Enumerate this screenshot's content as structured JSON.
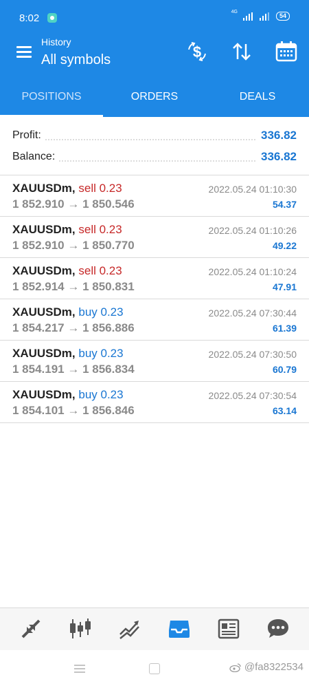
{
  "status_bar": {
    "time": "8:02",
    "network_label": "4G",
    "battery": "54"
  },
  "app_bar": {
    "subtitle": "History",
    "title": "All symbols"
  },
  "tabs": [
    {
      "label": "POSITIONS",
      "active": true
    },
    {
      "label": "ORDERS",
      "active": false
    },
    {
      "label": "DEALS",
      "active": false
    }
  ],
  "summary": {
    "profit_label": "Profit:",
    "profit_value": "336.82",
    "balance_label": "Balance:",
    "balance_value": "336.82"
  },
  "deals": [
    {
      "symbol": "XAUUSDm,",
      "type": "sell 0.23",
      "prices": "1 852.910 → 1 850.546",
      "time": "2022.05.24 01:10:30",
      "profit": "54.37"
    },
    {
      "symbol": "XAUUSDm,",
      "type": "sell 0.23",
      "prices": "1 852.910 → 1 850.770",
      "time": "2022.05.24 01:10:26",
      "profit": "49.22"
    },
    {
      "symbol": "XAUUSDm,",
      "type": "sell 0.23",
      "prices": "1 852.914 → 1 850.831",
      "time": "2022.05.24 01:10:24",
      "profit": "47.91"
    },
    {
      "symbol": "XAUUSDm,",
      "type": "buy 0.23",
      "prices": "1 854.217 → 1 856.886",
      "time": "2022.05.24 07:30:44",
      "profit": "61.39"
    },
    {
      "symbol": "XAUUSDm,",
      "type": "buy 0.23",
      "prices": "1 854.191 → 1 856.834",
      "time": "2022.05.24 07:30:50",
      "profit": "60.79"
    },
    {
      "symbol": "XAUUSDm,",
      "type": "buy 0.23",
      "prices": "1 854.101 → 1 856.846",
      "time": "2022.05.24 07:30:54",
      "profit": "63.14"
    }
  ],
  "bottom_nav": [
    {
      "icon": "quotes-icon",
      "active": false
    },
    {
      "icon": "chart-candles-icon",
      "active": false
    },
    {
      "icon": "trade-icon",
      "active": false
    },
    {
      "icon": "history-inbox-icon",
      "active": true
    },
    {
      "icon": "news-icon",
      "active": false
    },
    {
      "icon": "chat-icon",
      "active": false
    }
  ],
  "watermark": "@fa8322534",
  "colors": {
    "primary": "#1e88e5",
    "sell": "#c62828",
    "buy": "#1976d2",
    "profit": "#1976d2",
    "muted": "#8a8a8a"
  }
}
